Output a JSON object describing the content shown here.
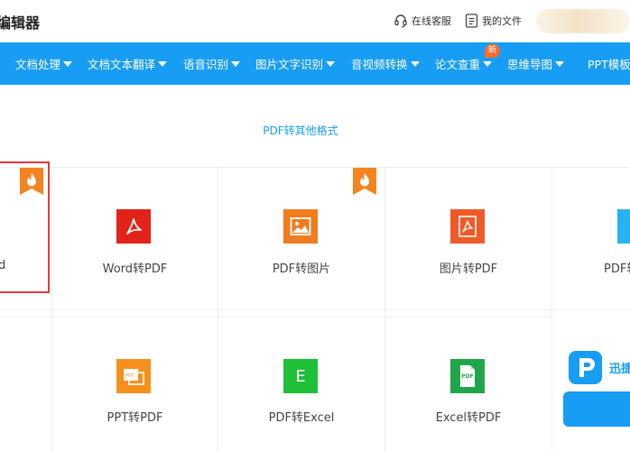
{
  "header": {
    "brand": "编辑器",
    "support_label": "在线客服",
    "files_label": "我的文件",
    "icons": [
      "headset-icon",
      "document-icon"
    ]
  },
  "nav": {
    "items": [
      {
        "label": "文档处理"
      },
      {
        "label": "文档文本翻译"
      },
      {
        "label": "语音识别"
      },
      {
        "label": "图片文字识别"
      },
      {
        "label": "音视频转换"
      },
      {
        "label": "论文查重"
      },
      {
        "label": "思维导图"
      },
      {
        "label": "PPT模板"
      }
    ],
    "new_badge": "新",
    "background": "#189df5"
  },
  "section": {
    "title": "PDF转其他格式"
  },
  "tools_row1": [
    {
      "label": "PDF转Word",
      "visible_text": "d"
    },
    {
      "label": "Word转PDF",
      "icon": "pdf-acrobat-icon",
      "color": "#e2231a"
    },
    {
      "label": "PDF转图片",
      "icon": "picture-icon",
      "color": "#f07c1f"
    },
    {
      "label": "图片转PDF",
      "icon": "pdf-acrobat-icon",
      "color": "#f05a28"
    },
    {
      "label": "PDF转"
    }
  ],
  "tools_row2": [
    {
      "label": "PPT转PDF",
      "icon": "ppt-pdf-icon",
      "color": "#f5901e"
    },
    {
      "label": "PDF转Excel",
      "icon": "excel-e-icon",
      "color": "#1fbf37",
      "glyph": "E"
    },
    {
      "label": "Excel转PDF",
      "icon": "pdf-file-icon",
      "color": "#20a64a",
      "glyph": "PDF"
    }
  ],
  "promo": {
    "text": "迅捷"
  },
  "colors": {
    "accent": "#189df5",
    "hot": "#f5831f",
    "selected_border": "#e0393e"
  }
}
